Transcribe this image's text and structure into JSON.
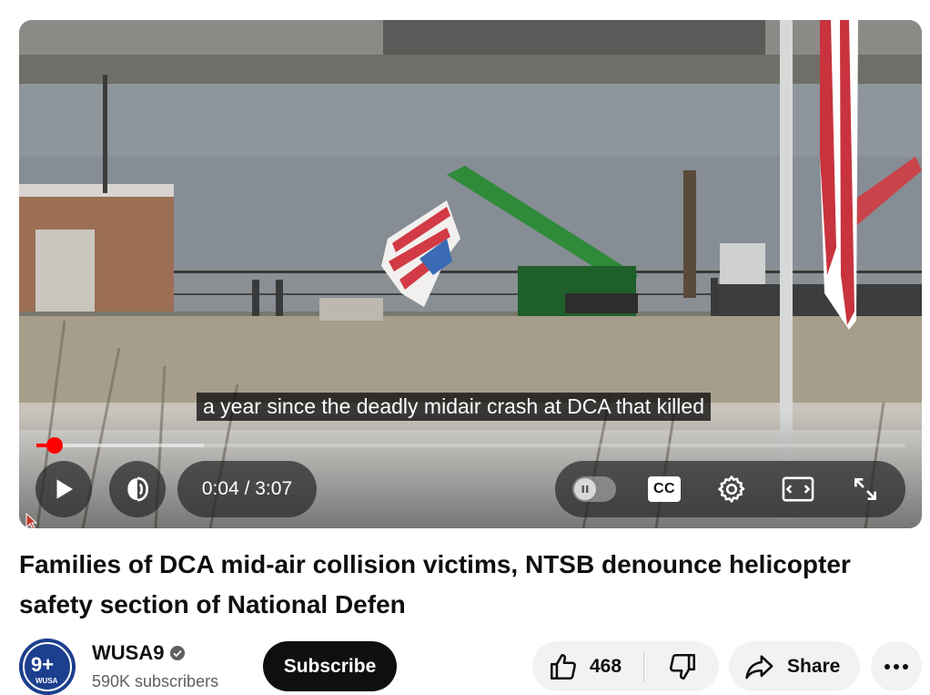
{
  "video": {
    "caption": "a year since the deadly midair crash at DCA that killed",
    "time_display": "0:04 / 3:07",
    "progress_fraction": 0.021,
    "buffered_fraction": 0.193,
    "controls": {
      "play_icon": "play-icon",
      "volume_icon": "volume-icon",
      "autoplay_icon": "pause-toggle-icon",
      "cc_label": "CC",
      "settings_icon": "gear-icon",
      "theater_icon": "theater-mode-icon",
      "fullscreen_icon": "fullscreen-icon"
    },
    "accent_color": "#ff0000"
  },
  "title": "Families of DCA mid-air collision victims, NTSB denounce helicopter safety section of National Defen",
  "channel": {
    "name": "WUSA9",
    "verified_icon": "verified-check-icon",
    "subscribers": "590K subscribers",
    "avatar_text": "9+",
    "avatar_subtext": "WUSA"
  },
  "actions": {
    "subscribe_label": "Subscribe",
    "like_count": "468",
    "share_label": "Share",
    "more_icon": "more-horizontal-icon"
  }
}
